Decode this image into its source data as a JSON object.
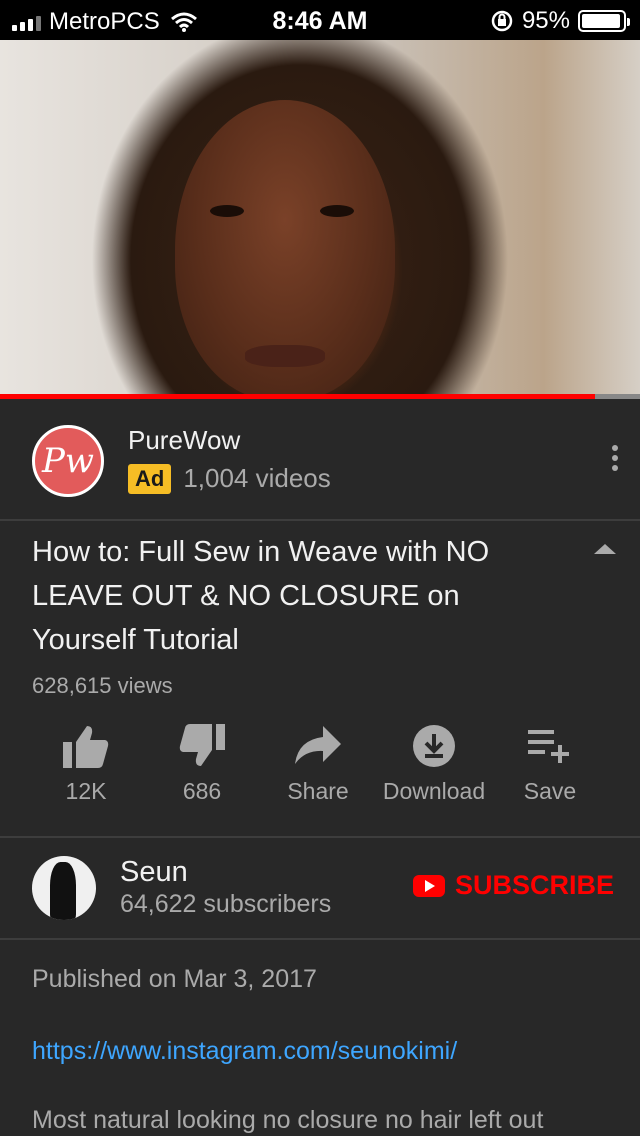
{
  "status_bar": {
    "carrier": "MetroPCS",
    "time": "8:46 AM",
    "battery": "95%",
    "battery_level": 0.95
  },
  "video": {
    "progress": 0.93
  },
  "ad": {
    "logo_text": "Pw",
    "name": "PureWow",
    "badge": "Ad",
    "video_count": "1,004 videos"
  },
  "video_info": {
    "title": "How to: Full Sew in Weave with NO LEAVE OUT & NO CLOSURE on Yourself Tutorial",
    "views": "628,615 views"
  },
  "actions": [
    {
      "label": "12K",
      "icon": "thumbs-up-icon"
    },
    {
      "label": "686",
      "icon": "thumbs-down-icon"
    },
    {
      "label": "Share",
      "icon": "share-icon"
    },
    {
      "label": "Download",
      "icon": "download-icon"
    },
    {
      "label": "Save",
      "icon": "playlist-add-icon"
    }
  ],
  "channel": {
    "name": "Seun",
    "subscribers": "64,622 subscribers",
    "subscribe_label": "SUBSCRIBE"
  },
  "description": {
    "published": "Published on Mar 3, 2017",
    "link": "https://www.instagram.com/seunokimi/",
    "text": "Most natural looking no closure no hair left out"
  },
  "colors": {
    "background": "#282828",
    "accent_red": "#ff0000",
    "link_blue": "#3ea6ff",
    "ad_badge": "#f6bd25",
    "secondary_text": "#aaaaaa"
  }
}
